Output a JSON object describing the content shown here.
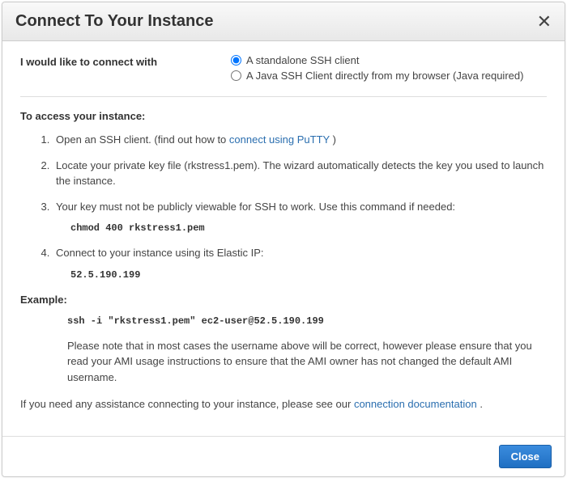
{
  "header": {
    "title": "Connect To Your Instance"
  },
  "connect": {
    "label": "I would like to connect with",
    "options": {
      "standalone": "A standalone SSH client",
      "java": "A Java SSH Client directly from my browser (Java required)"
    }
  },
  "access": {
    "heading": "To access your instance:",
    "step1_prefix": "Open an SSH client. (find out how to ",
    "step1_link": "connect using PuTTY",
    "step1_suffix": ")",
    "step2": "Locate your private key file (rkstress1.pem). The wizard automatically detects the key you used to launch the instance.",
    "step3_text": "Your key must not be publicly viewable for SSH to work. Use this command if needed:",
    "step3_cmd": "chmod 400 rkstress1.pem",
    "step4_text": "Connect to your instance using its Elastic IP:",
    "step4_ip": "52.5.190.199"
  },
  "example": {
    "label": "Example:",
    "cmd": "ssh -i \"rkstress1.pem\" ec2-user@52.5.190.199",
    "note": "Please note that in most cases the username above will be correct, however please ensure that you read your AMI usage instructions to ensure that the AMI owner has not changed the default AMI username."
  },
  "assist": {
    "prefix": "If you need any assistance connecting to your instance, please see our ",
    "link": "connection documentation",
    "suffix": "."
  },
  "footer": {
    "close_label": "Close"
  }
}
